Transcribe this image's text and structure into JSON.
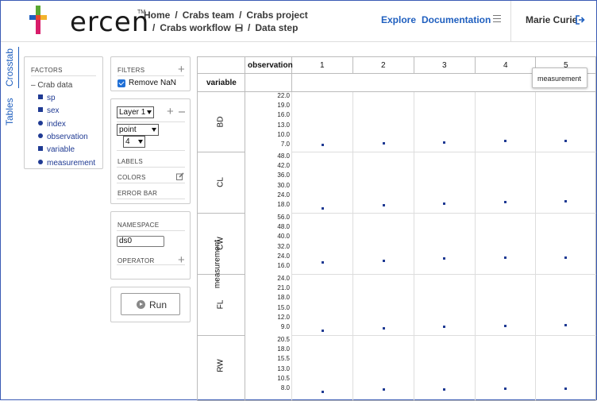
{
  "header": {
    "logo_text": "ercen",
    "logo_tm": "TM",
    "breadcrumb_row1": [
      "Home",
      "Crabs team",
      "Crabs project"
    ],
    "breadcrumb_row2": [
      "Crabs workflow",
      "Data step"
    ],
    "nav_explore": "Explore",
    "nav_documentation": "Documentation",
    "user_name": "Marie Curie",
    "accent_color": "#1f5fbf"
  },
  "side_tabs": [
    "Crosstab",
    "Tables"
  ],
  "factors": {
    "title": "FACTORS",
    "group": "Crab data",
    "items": [
      {
        "label": "sp",
        "shape": "square"
      },
      {
        "label": "sex",
        "shape": "square"
      },
      {
        "label": "index",
        "shape": "circle"
      },
      {
        "label": "observation",
        "shape": "circle"
      },
      {
        "label": "variable",
        "shape": "square"
      },
      {
        "label": "measurement",
        "shape": "circle"
      }
    ]
  },
  "filters": {
    "title": "FILTERS",
    "remove_nan_label": "Remove NaN",
    "remove_nan_checked": true
  },
  "layer": {
    "layer_select": "Layer 1",
    "chart_type_select": "point",
    "size_select": "4",
    "labels_title": "LABELS",
    "colors_title": "COLORS",
    "error_bar_title": "ERROR BAR"
  },
  "namespace": {
    "title": "NAMESPACE",
    "value": "ds0",
    "operator_title": "OPERATOR"
  },
  "run_label": "Run",
  "crosstab": {
    "col_factor": "observation",
    "row_factor": "variable",
    "y_axis_label": "measurement",
    "tooltip": "measurement",
    "columns": [
      "1",
      "2",
      "3",
      "4",
      "5"
    ]
  },
  "chart_data": {
    "type": "scatter",
    "columns": [
      "1",
      "2",
      "3",
      "4",
      "5"
    ],
    "x": [
      1,
      2,
      3,
      4,
      5
    ],
    "rows": [
      {
        "name": "BD",
        "ticks": [
          "22.0",
          "19.0",
          "16.0",
          "13.0",
          "10.0",
          "7.0"
        ],
        "ylim": [
          7,
          22
        ],
        "values": [
          7.0,
          7.4,
          7.7,
          8.2,
          8.2
        ]
      },
      {
        "name": "CL",
        "ticks": [
          "48.0",
          "42.0",
          "36.0",
          "30.0",
          "24.0",
          "18.0"
        ],
        "ylim": [
          18,
          48
        ],
        "values": [
          16.1,
          18.1,
          19.0,
          20.1,
          20.3
        ]
      },
      {
        "name": "CW",
        "ticks": [
          "56.0",
          "48.0",
          "40.0",
          "32.0",
          "24.0",
          "16.0"
        ],
        "ylim": [
          16,
          56
        ],
        "values": [
          19.0,
          20.5,
          22.5,
          23.1,
          23.0
        ]
      },
      {
        "name": "FL",
        "ticks": [
          "24.0",
          "21.0",
          "18.0",
          "15.0",
          "12.0",
          "9.0"
        ],
        "ylim": [
          9,
          24
        ],
        "values": [
          8.1,
          8.8,
          9.2,
          9.6,
          9.8
        ]
      },
      {
        "name": "RW",
        "ticks": [
          "20.5",
          "18.0",
          "15.5",
          "13.0",
          "10.5",
          "8.0"
        ],
        "ylim": [
          8,
          20.5
        ],
        "values": [
          6.7,
          7.7,
          7.8,
          7.9,
          8.0
        ]
      }
    ]
  }
}
